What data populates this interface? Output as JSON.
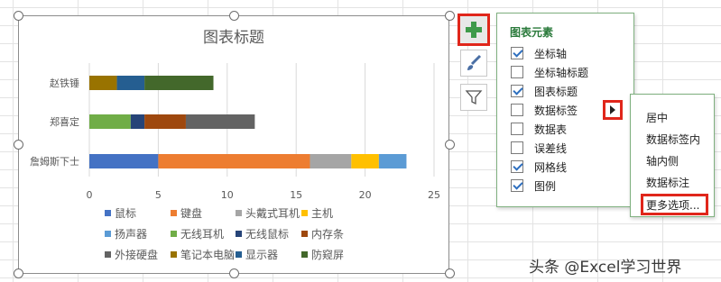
{
  "chart_data": {
    "type": "bar",
    "orientation": "horizontal",
    "stacked": true,
    "title": "图表标题",
    "categories": [
      "赵铁锤",
      "郑喜定",
      "詹姆斯下士"
    ],
    "xlim": [
      0,
      25
    ],
    "x_ticks": [
      "0",
      "5",
      "10",
      "15",
      "20",
      "25"
    ],
    "grid": true,
    "legend_position": "bottom",
    "series": [
      {
        "name": "鼠标",
        "color": "#4472c4",
        "values": [
          0,
          0,
          5
        ]
      },
      {
        "name": "键盘",
        "color": "#ed7d31",
        "values": [
          0,
          0,
          11
        ]
      },
      {
        "name": "头戴式耳机",
        "color": "#a5a5a5",
        "values": [
          0,
          0,
          3
        ]
      },
      {
        "name": "主机",
        "color": "#ffc000",
        "values": [
          0,
          0,
          2
        ]
      },
      {
        "name": "扬声器",
        "color": "#5b9bd5",
        "values": [
          0,
          0,
          2
        ]
      },
      {
        "name": "无线耳机",
        "color": "#70ad47",
        "values": [
          0,
          3,
          0
        ]
      },
      {
        "name": "无线鼠标",
        "color": "#264478",
        "values": [
          0,
          1,
          0
        ]
      },
      {
        "name": "内存条",
        "color": "#9e480e",
        "values": [
          0,
          3,
          0
        ]
      },
      {
        "name": "外接硬盘",
        "color": "#636363",
        "values": [
          0,
          5,
          0
        ]
      },
      {
        "name": "笔记本电脑",
        "color": "#997300",
        "values": [
          2,
          0,
          0
        ]
      },
      {
        "name": "显示器",
        "color": "#255e91",
        "values": [
          2,
          0,
          0
        ]
      },
      {
        "name": "防窥屏",
        "color": "#43682b",
        "values": [
          5,
          0,
          0
        ]
      }
    ]
  },
  "side_buttons": {
    "elements_icon": "plus-icon",
    "styles_icon": "brush-icon",
    "filter_icon": "filter-icon"
  },
  "panel": {
    "title": "图表元素",
    "items": [
      {
        "label": "坐标轴",
        "checked": true
      },
      {
        "label": "坐标轴标题",
        "checked": false
      },
      {
        "label": "图表标题",
        "checked": true
      },
      {
        "label": "数据标签",
        "checked": false
      },
      {
        "label": "数据表",
        "checked": false
      },
      {
        "label": "误差线",
        "checked": false
      },
      {
        "label": "网格线",
        "checked": true
      },
      {
        "label": "图例",
        "checked": true
      }
    ]
  },
  "submenu": {
    "items": [
      "居中",
      "数据标签内",
      "轴内侧",
      "数据标注",
      "更多选项..."
    ]
  },
  "watermark": "头条 @Excel学习世界"
}
